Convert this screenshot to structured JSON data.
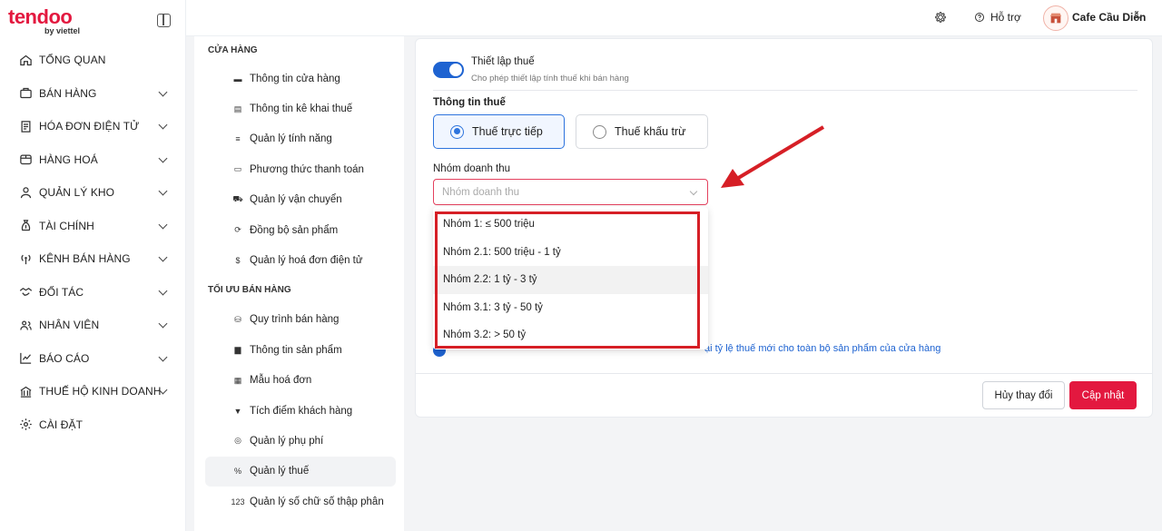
{
  "logo": {
    "brand": "tendoo",
    "sub": "by viettel"
  },
  "sidebar": {
    "items": [
      {
        "label": "TỔNG QUAN",
        "icon": "home-icon",
        "chevron": false
      },
      {
        "label": "BÁN HÀNG",
        "icon": "cart-icon",
        "chevron": true
      },
      {
        "label": "HÓA ĐƠN ĐIỆN TỬ",
        "icon": "invoice-icon",
        "chevron": true
      },
      {
        "label": "HÀNG HOÁ",
        "icon": "box-icon",
        "chevron": true
      },
      {
        "label": "QUẢN LÝ KHO",
        "icon": "warehouse-icon",
        "chevron": true
      },
      {
        "label": "TÀI CHÍNH",
        "icon": "money-bag-icon",
        "chevron": true
      },
      {
        "label": "KÊNH BÁN HÀNG",
        "icon": "broadcast-icon",
        "chevron": true
      },
      {
        "label": "ĐỐI TÁC",
        "icon": "handshake-icon",
        "chevron": true
      },
      {
        "label": "NHÂN VIÊN",
        "icon": "staff-icon",
        "chevron": true
      },
      {
        "label": "BÁO CÁO",
        "icon": "chart-icon",
        "chevron": true
      },
      {
        "label": "THUẾ HỘ KINH DOANH",
        "icon": "tax-icon",
        "chevron": true
      },
      {
        "label": "CÀI ĐẶT",
        "icon": "gear-icon",
        "chevron": false
      }
    ]
  },
  "header": {
    "help_label": "Hỗ trợ",
    "store_name": "Cafe Cầu Diễn"
  },
  "submenu": {
    "section1": "CỬA HÀNG",
    "items1": [
      {
        "label": "Thông tin cửa hàng",
        "icon": "store-icon",
        "glyph": "▬"
      },
      {
        "label": "Thông tin kê khai thuế",
        "icon": "document-icon",
        "glyph": "▤"
      },
      {
        "label": "Quản lý tính năng",
        "icon": "menu-lines-icon",
        "glyph": "≡"
      },
      {
        "label": "Phương thức thanh toán",
        "icon": "credit-card-icon",
        "glyph": "▭"
      },
      {
        "label": "Quản lý vận chuyển",
        "icon": "truck-icon",
        "glyph": "⛟"
      },
      {
        "label": "Đồng bộ sản phẩm",
        "icon": "sync-icon",
        "glyph": "⟳"
      },
      {
        "label": "Quản lý hoá đơn điện tử",
        "icon": "dollar-circle-icon",
        "glyph": "$"
      }
    ],
    "section2": "TỐI ƯU BÁN HÀNG",
    "items2": [
      {
        "label": "Quy trình bán hàng",
        "icon": "basket-icon",
        "glyph": "⛁"
      },
      {
        "label": "Thông tin sản phẩm",
        "icon": "archive-icon",
        "glyph": "▆"
      },
      {
        "label": "Mẫu hoá đơn",
        "icon": "receipt-icon",
        "glyph": "▦"
      },
      {
        "label": "Tích điểm khách hàng",
        "icon": "bookmark-icon",
        "glyph": "▼"
      },
      {
        "label": "Quản lý phụ phí",
        "icon": "coins-icon",
        "glyph": "◎"
      },
      {
        "label": "Quản lý thuế",
        "icon": "percent-icon",
        "glyph": "%"
      },
      {
        "label": "Quản lý số chữ số thập phân",
        "icon": "numbers-icon",
        "glyph": "123"
      }
    ]
  },
  "tax_settings": {
    "title": "Thiết lập thuế",
    "description": "Cho phép thiết lập tính thuế khi bán hàng",
    "toggle_on": true,
    "info_title": "Thông tin thuế",
    "options": [
      "Thuế trực tiếp",
      "Thuế khấu trừ"
    ],
    "selected_option": "Thuế trực tiếp",
    "group_label": "Nhóm doanh thu",
    "group_placeholder": "Nhóm doanh thu",
    "background_link_fragment": "ại tỷ lệ thuế mới cho toàn bộ sản phẩm của cửa hàng"
  },
  "dropdown": {
    "options": [
      "Nhóm 1: ≤ 500 triệu",
      "Nhóm 2.1: 500 triệu - 1 tỷ",
      "Nhóm 2.2: 1 tỷ - 3 tỷ",
      "Nhóm 3.1: 3 tỷ - 50 tỷ",
      "Nhóm 3.2: > 50 tỷ"
    ],
    "hovered_index": 2
  },
  "actions": {
    "cancel": "Hủy thay đổi",
    "update": "Cập nhật"
  },
  "colors": {
    "brand": "#e3183f",
    "accent": "#1e63d1",
    "annotation": "#d61f26"
  }
}
